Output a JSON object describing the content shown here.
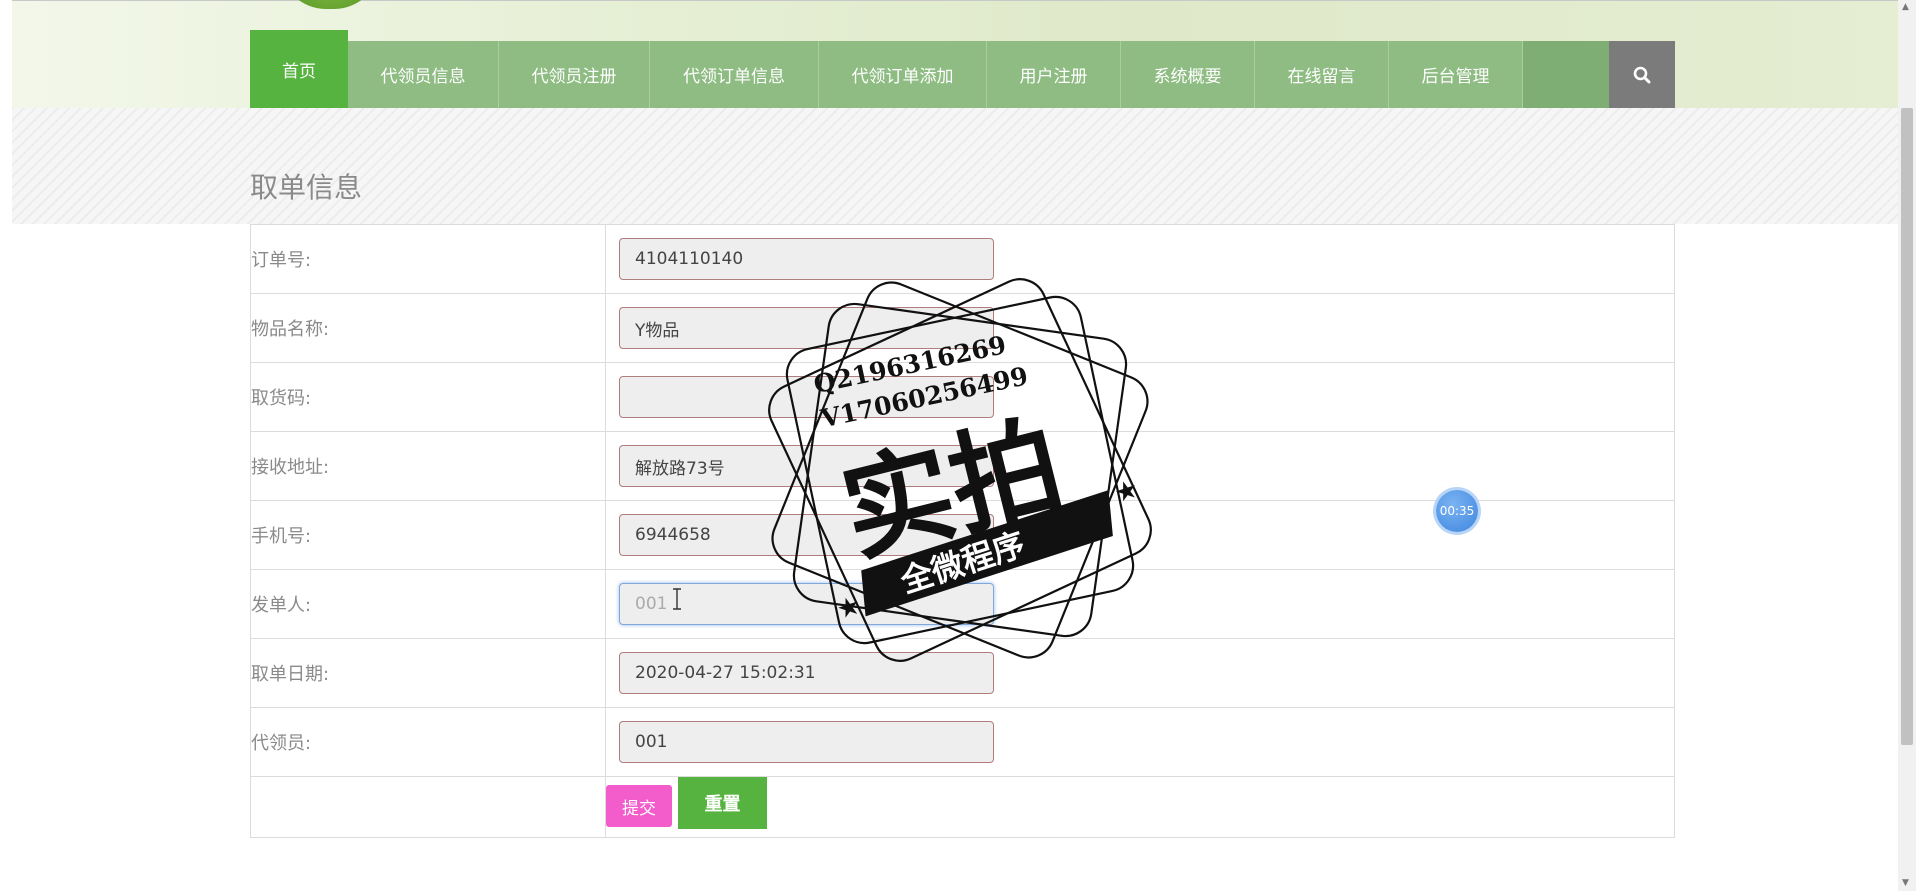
{
  "nav": {
    "items": [
      {
        "label": "首页",
        "active": true
      },
      {
        "label": "代领员信息"
      },
      {
        "label": "代领员注册"
      },
      {
        "label": "代领订单信息"
      },
      {
        "label": "代领订单添加"
      },
      {
        "label": "用户注册"
      },
      {
        "label": "系统概要"
      },
      {
        "label": "在线留言"
      },
      {
        "label": "后台管理"
      }
    ],
    "search_icon": "search-icon"
  },
  "page": {
    "title": "取单信息"
  },
  "form": {
    "fields": [
      {
        "label": "订单号:",
        "value": "4104110140"
      },
      {
        "label": "物品名称:",
        "value": "Y物品"
      },
      {
        "label": "取货码:",
        "value": ""
      },
      {
        "label": "接收地址:",
        "value": "解放路73号"
      },
      {
        "label": "手机号:",
        "value": "6944658"
      },
      {
        "label": "发单人:",
        "value": "001"
      },
      {
        "label": "取单日期:",
        "value": "2020-04-27 15:02:31"
      },
      {
        "label": "代领员:",
        "value": "001"
      }
    ],
    "submit_label": "提交",
    "reset_label": "重置"
  },
  "timer": {
    "text": "00:35"
  },
  "watermark": {
    "contact_line1": "Q2196316269",
    "contact_line2": "V17060256499",
    "main_text": "实拍",
    "ribbon_text": "全微程序"
  },
  "colors": {
    "nav_active": "#57b340",
    "nav_item": "#8ebc82",
    "submit": "#f25ccb",
    "reset": "#57b340",
    "search_bg": "#7b7b7b"
  }
}
